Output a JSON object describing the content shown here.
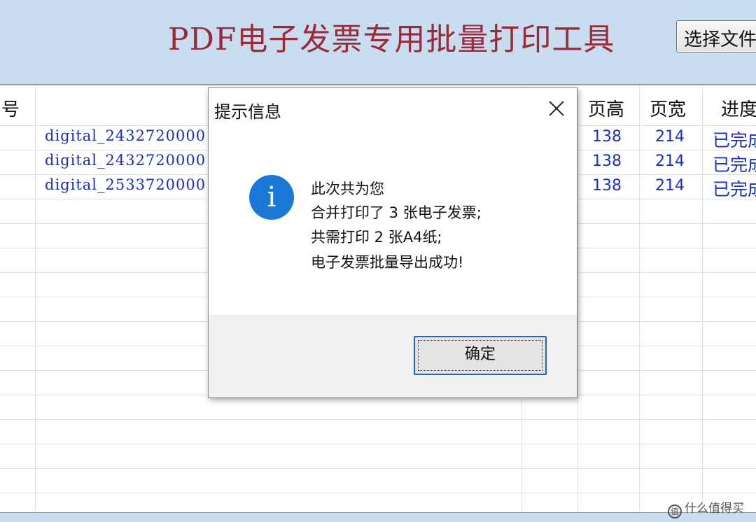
{
  "header": {
    "title": "PDF电子发票专用批量打印工具",
    "select_file_button": "选择文件"
  },
  "table": {
    "columns": [
      "号",
      "",
      "页高",
      "页宽",
      "进度"
    ],
    "rows": [
      {
        "file": "digital_2432720000",
        "height": "138",
        "width": "214",
        "status": "已完成"
      },
      {
        "file": "digital_2432720000",
        "height": "138",
        "width": "214",
        "status": "已完成"
      },
      {
        "file": "digital_2533720000",
        "height": "138",
        "width": "214",
        "status": "已完成"
      }
    ]
  },
  "dialog": {
    "title": "提示信息",
    "icon": "info-icon",
    "lines": [
      "此次共为您",
      "合并打印了 3 张电子发票;",
      "共需打印 2 张A4纸;",
      "电子发票批量导出成功!"
    ],
    "ok_button": "确定"
  },
  "watermark": "值 什么值得买",
  "colors": {
    "header_bg": "#c9ddf1",
    "title_color": "#9b2a3a",
    "cell_text": "#1a2ecc",
    "info_icon": "#1a78d6",
    "ok_border": "#1f64c7"
  }
}
